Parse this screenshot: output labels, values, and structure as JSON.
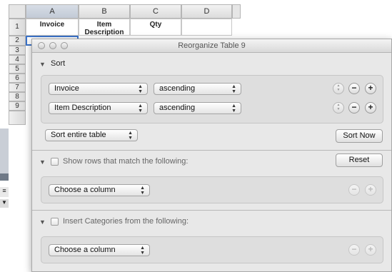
{
  "spreadsheet": {
    "columns": [
      "A",
      "B",
      "C",
      "D"
    ],
    "rows": [
      "1",
      "2",
      "3",
      "4",
      "5",
      "6",
      "7",
      "8",
      "9"
    ],
    "headers": {
      "a": "Invoice",
      "b": "Item\nDescription",
      "c": "Qty"
    }
  },
  "dialog": {
    "title": "Reorganize Table 9",
    "sort": {
      "label": "Sort",
      "rules": [
        {
          "column": "Invoice",
          "order": "ascending"
        },
        {
          "column": "Item Description",
          "order": "ascending"
        }
      ],
      "scope": "Sort entire table",
      "sort_now": "Sort Now"
    },
    "filter": {
      "label": "Show rows that match the following:",
      "reset": "Reset",
      "column_placeholder": "Choose a column"
    },
    "categories": {
      "label": "Insert Categories from the following:",
      "column_placeholder": "Choose a column"
    },
    "icons": {
      "add": "plus-icon",
      "remove": "minus-icon",
      "reorder": "reorder-icon",
      "disclosure": "disclosure-triangle-icon"
    }
  }
}
